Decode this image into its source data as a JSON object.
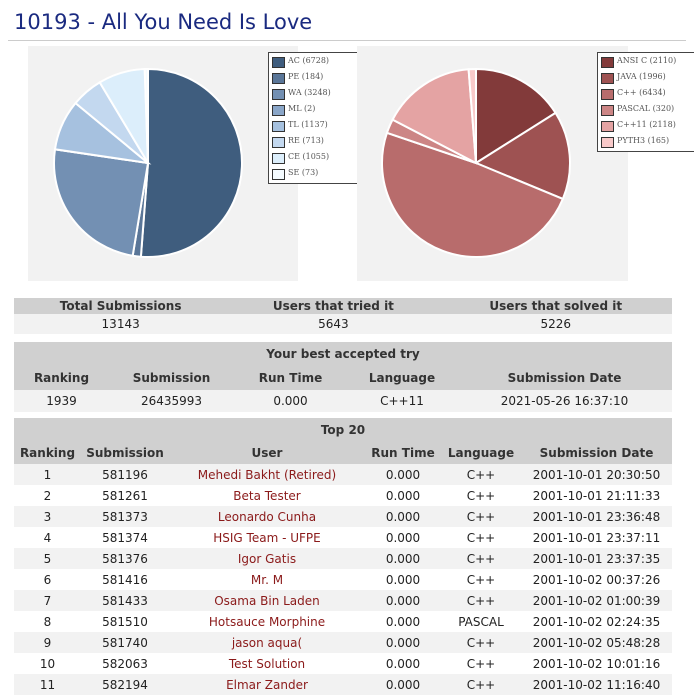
{
  "page": {
    "title": "10193 - All You Need Is Love"
  },
  "chart_data": [
    {
      "type": "pie",
      "title": "",
      "legend": "right",
      "categories": [
        "AC (6728)",
        "PE (184)",
        "WA (3248)",
        "ML (2)",
        "TL (1137)",
        "RE (713)",
        "CE (1055)",
        "SE (73)"
      ],
      "values": [
        6728,
        184,
        3248,
        2,
        1137,
        713,
        1055,
        73
      ],
      "colors": [
        "#3f5d7e",
        "#5a7698",
        "#7390b3",
        "#8aa6c8",
        "#a6c1df",
        "#c3d8ef",
        "#dceefb",
        "#f4fbff"
      ]
    },
    {
      "type": "pie",
      "title": "",
      "legend": "right",
      "categories": [
        "ANSI C (2110)",
        "JAVA (1996)",
        "C++ (6434)",
        "PASCAL (320)",
        "C++11 (2118)",
        "PYTH3 (165)"
      ],
      "values": [
        2110,
        1996,
        6434,
        320,
        2118,
        165
      ],
      "colors": [
        "#823a3a",
        "#9e5252",
        "#b86c6c",
        "#cc8585",
        "#e4a3a3",
        "#f9caca"
      ]
    }
  ],
  "summary": {
    "headers": [
      "Total Submissions",
      "Users that tried it",
      "Users that solved it"
    ],
    "values": [
      "13143",
      "5643",
      "5226"
    ]
  },
  "best_try": {
    "caption": "Your best accepted try",
    "headers": [
      "Ranking",
      "Submission",
      "Run Time",
      "Language",
      "Submission Date"
    ],
    "row": [
      "1939",
      "26435993",
      "0.000",
      "C++11",
      "2021-05-26 16:37:10"
    ]
  },
  "top20": {
    "caption": "Top 20",
    "headers": [
      "Ranking",
      "Submission",
      "User",
      "Run Time",
      "Language",
      "Submission Date"
    ],
    "rows": [
      [
        "1",
        "581196",
        "Mehedi Bakht (Retired)",
        "0.000",
        "C++",
        "2001-10-01 20:30:50"
      ],
      [
        "2",
        "581261",
        "Beta Tester",
        "0.000",
        "C++",
        "2001-10-01 21:11:33"
      ],
      [
        "3",
        "581373",
        "Leonardo Cunha",
        "0.000",
        "C++",
        "2001-10-01 23:36:48"
      ],
      [
        "4",
        "581374",
        "HSIG Team - UFPE",
        "0.000",
        "C++",
        "2001-10-01 23:37:11"
      ],
      [
        "5",
        "581376",
        "Igor Gatis",
        "0.000",
        "C++",
        "2001-10-01 23:37:35"
      ],
      [
        "6",
        "581416",
        "Mr. M",
        "0.000",
        "C++",
        "2001-10-02 00:37:26"
      ],
      [
        "7",
        "581433",
        "Osama Bin Laden",
        "0.000",
        "C++",
        "2001-10-02 01:00:39"
      ],
      [
        "8",
        "581510",
        "Hotsauce Morphine",
        "0.000",
        "PASCAL",
        "2001-10-02 02:24:35"
      ],
      [
        "9",
        "581740",
        "jason aqua(",
        "0.000",
        "C++",
        "2001-10-02 05:48:28"
      ],
      [
        "10",
        "582063",
        "Test Solution",
        "0.000",
        "C++",
        "2001-10-02 10:01:16"
      ],
      [
        "11",
        "582194",
        "Elmar Zander",
        "0.000",
        "C++",
        "2001-10-02 11:16:40"
      ]
    ]
  }
}
